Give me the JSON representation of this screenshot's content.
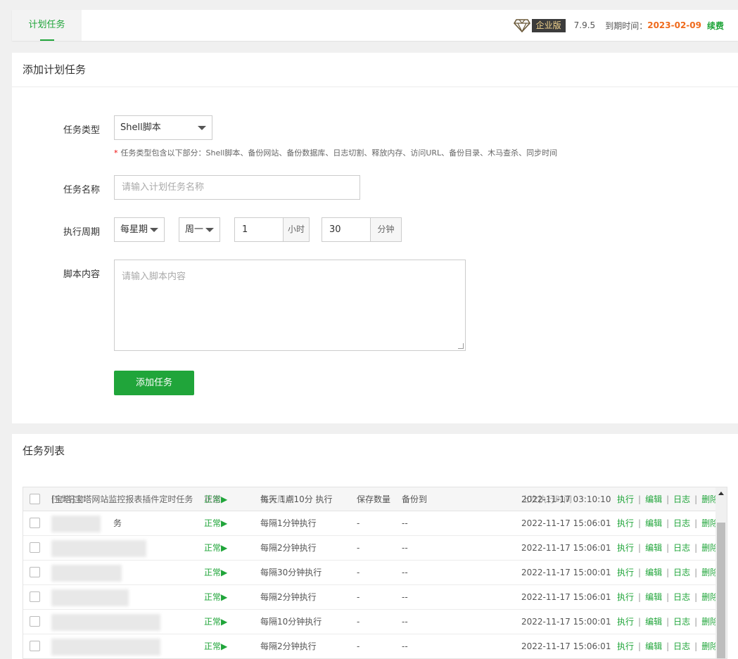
{
  "topbar": {
    "tab_label": "计划任务",
    "edition_badge": "企业版",
    "version": "7.9.5",
    "expire_label": "到期时间：",
    "expire_date": "2023-02-09",
    "renew_label": "续费"
  },
  "form": {
    "title": "添加计划任务",
    "task_type_label": "任务类型",
    "task_type_value": "Shell脚本",
    "hint_star": "*",
    "hint_text": "任务类型包含以下部分：Shell脚本、备份网站、备份数据库、日志切割、释放内存、访问URL、备份目录、木马查杀、同步时间",
    "task_name_label": "任务名称",
    "task_name_placeholder": "请输入计划任务名称",
    "period_label": "执行周期",
    "period_type": "每星期",
    "weekday": "周一",
    "hour_value": "1",
    "hour_unit": "小时",
    "minute_value": "30",
    "minute_unit": "分钟",
    "script_label": "脚本内容",
    "script_placeholder": "请输入脚本内容",
    "add_button": "添加任务"
  },
  "list": {
    "title": "任务列表",
    "header_overlap": {
      "name": "[宝塔]宝塔网站监控报表插件定时任务",
      "name_hdr": "任务名称",
      "status": "正常▶",
      "status_hdr": "状态",
      "period": "每天 1点10分 执行",
      "period_hdr": "执行周期",
      "save_count_hdr": "保存数量",
      "backup_to_hdr": "备份到",
      "last_time": "2022-11-17 03:10:10",
      "last_time_hdr": "上次执行时间"
    },
    "actions": [
      "执行",
      "编辑",
      "日志",
      "删除"
    ],
    "rows": [
      {
        "name": "务",
        "status": "正常▶",
        "period": "每隔1分钟执行",
        "save_count": "-",
        "backup_to": "--",
        "last_time": "2022-11-17 15:06:01"
      },
      {
        "name": "",
        "status": "正常▶",
        "period": "每隔2分钟执行",
        "save_count": "-",
        "backup_to": "--",
        "last_time": "2022-11-17 15:06:01"
      },
      {
        "name": "",
        "status": "正常▶",
        "period": "每隔30分钟执行",
        "save_count": "-",
        "backup_to": "--",
        "last_time": "2022-11-17 15:00:01"
      },
      {
        "name": "",
        "status": "正常▶",
        "period": "每隔2分钟执行",
        "save_count": "-",
        "backup_to": "--",
        "last_time": "2022-11-17 15:06:01"
      },
      {
        "name": "",
        "status": "正常▶",
        "period": "每隔10分钟执行",
        "save_count": "-",
        "backup_to": "--",
        "last_time": "2022-11-17 15:00:01"
      },
      {
        "name": "",
        "status": "正常▶",
        "period": "每隔2分钟执行",
        "save_count": "-",
        "backup_to": "--",
        "last_time": "2022-11-17 15:06:01"
      }
    ]
  },
  "colors": {
    "accent": "#20a53a",
    "expire": "#ef6a1c",
    "badge_bg": "#3c3c3c",
    "badge_text": "#f3d48e"
  },
  "icons": {
    "edition": "diamond-icon",
    "dropdown": "caret-down-icon",
    "scroll_up": "arrow-up-icon"
  }
}
